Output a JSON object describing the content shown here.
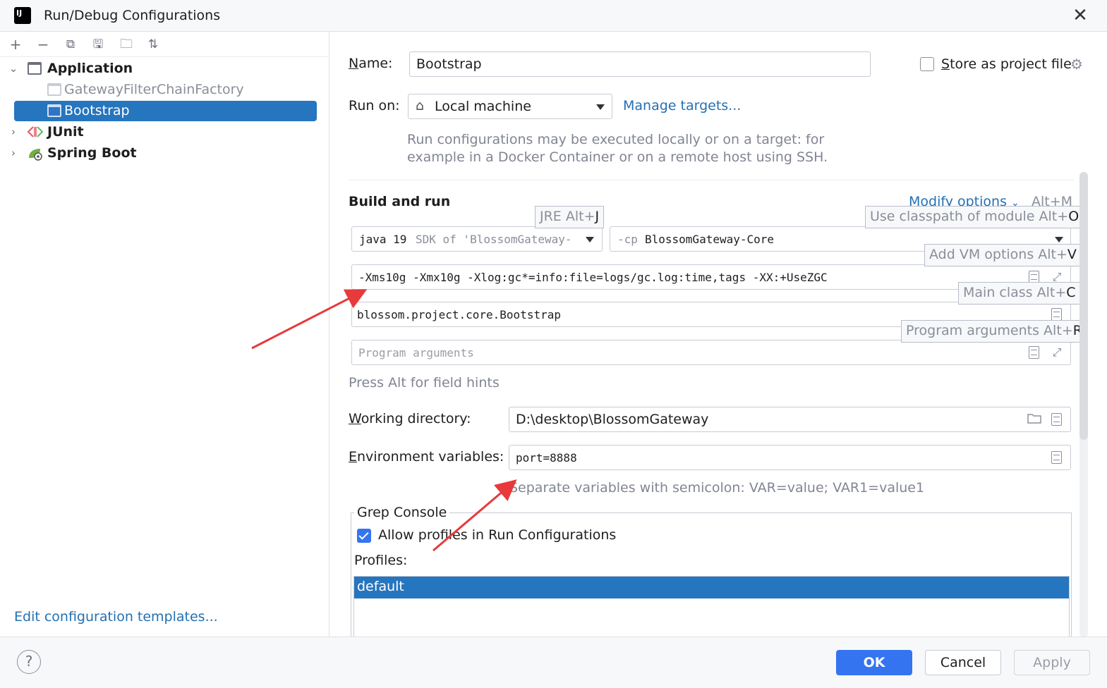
{
  "window": {
    "title": "Run/Debug Configurations",
    "app_icon_text": "IJ",
    "close_glyph": "✕"
  },
  "sidebar": {
    "toolbar": [
      {
        "name": "add-icon",
        "glyph": "+"
      },
      {
        "name": "remove-icon",
        "glyph": "−"
      },
      {
        "name": "copy-icon",
        "glyph": "⧉"
      },
      {
        "name": "save-icon",
        "glyph": "🖫"
      },
      {
        "name": "new-folder-icon",
        "glyph": "🗀"
      },
      {
        "name": "sort-icon",
        "glyph": "⇅"
      }
    ],
    "tree": {
      "application": "Application",
      "gateway_filter": "GatewayFilterChainFactory",
      "bootstrap": "Bootstrap",
      "junit": "JUnit",
      "spring_boot": "Spring Boot"
    },
    "edit_templates": "Edit configuration templates..."
  },
  "form": {
    "name_label_first": "N",
    "name_label_rest": "ame:",
    "name_value": "Bootstrap",
    "store_first": "S",
    "store_rest": "tore as project file",
    "store_checked": false,
    "run_on_label": "Run on:",
    "run_on_value": "Local machine",
    "manage_targets": "Manage targets...",
    "run_on_hint_line1": "Run configurations may be executed locally or on a target: for",
    "run_on_hint_line2": "example in a Docker Container or on a remote host using SSH.",
    "build_and_run": "Build and run",
    "modify_options": "Modify options",
    "modify_shortcut": "Alt+M",
    "jre_main": "java 19",
    "jre_detail": "SDK of 'BlossomGateway-",
    "cp_flag": "-cp",
    "cp_module": "BlossomGateway-Core",
    "vm_options": "-Xms10g -Xmx10g -Xlog:gc*=info:file=logs/gc.log:time,tags  -XX:+UseZGC",
    "main_class": "blossom.project.core.Bootstrap",
    "program_args_placeholder": "Program arguments",
    "field_hints": "Press Alt for field hints",
    "workdir_first": "W",
    "workdir_rest": "orking directory:",
    "workdir_value": "D:\\desktop\\BlossomGateway",
    "env_first": "E",
    "env_rest": "nvironment variables:",
    "env_value": "port=8888",
    "env_hint": "Separate variables with semicolon: VAR=value; VAR1=value1"
  },
  "tooltips": {
    "jre": "JRE Alt+",
    "jre_key": "J",
    "classpath": "Use classpath of module Alt+",
    "classpath_key": "O",
    "vm": "Add VM options Alt+",
    "vm_key": "V",
    "main": "Main class Alt+",
    "main_key": "C",
    "args": "Program arguments Alt+",
    "args_key": "R"
  },
  "grep_console": {
    "title": "Grep Console",
    "allow_profiles": "Allow profiles in Run Configurations",
    "allow_checked": true,
    "profiles_label": "Profiles:",
    "profiles": [
      "default"
    ]
  },
  "buttons": {
    "help": "?",
    "ok": "OK",
    "cancel": "Cancel",
    "apply": "Apply"
  },
  "colors": {
    "accent": "#3574f0",
    "selection": "#2675bf",
    "link": "#2470b3",
    "arrow": "#e8393b"
  }
}
